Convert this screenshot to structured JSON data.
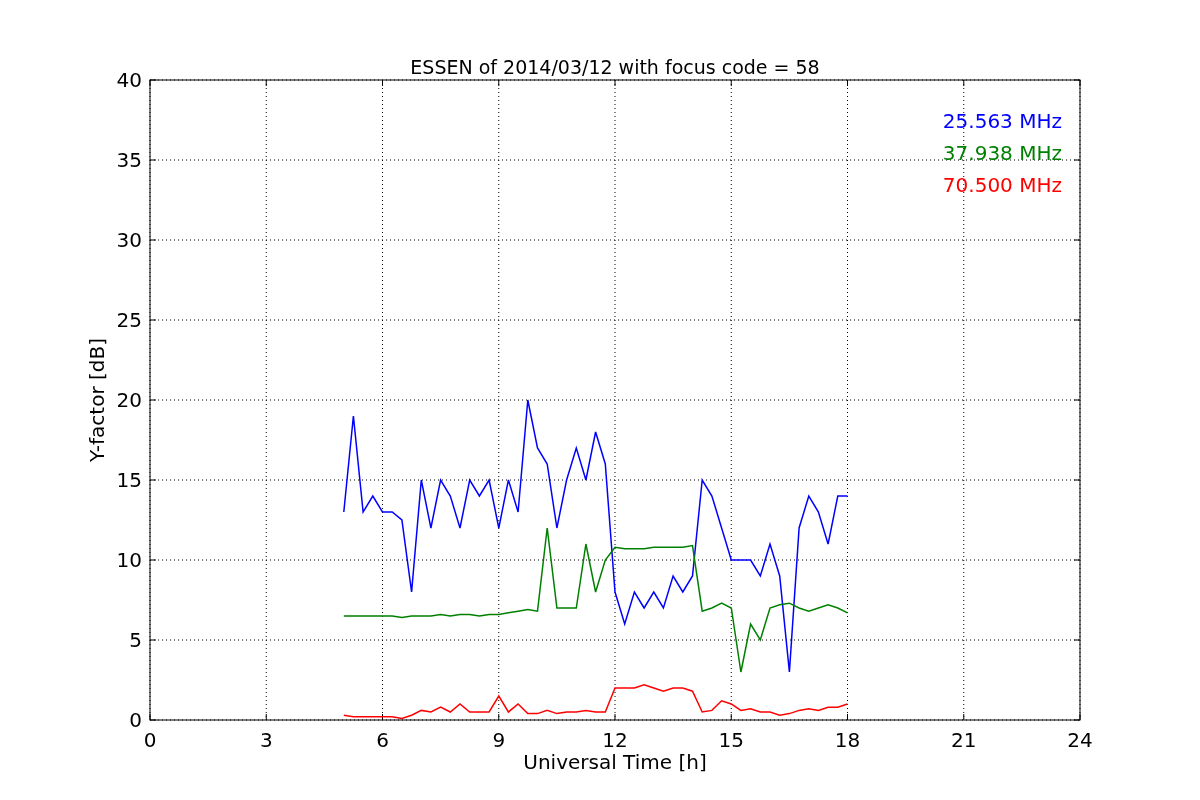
{
  "chart_data": {
    "type": "line",
    "title": "ESSEN of 2014/03/12 with focus code = 58",
    "xlabel": "Universal Time [h]",
    "ylabel": "Y-factor [dB]",
    "grid": true,
    "xlim": [
      0,
      24
    ],
    "ylim": [
      0,
      40
    ],
    "xticks": [
      0,
      3,
      6,
      9,
      12,
      15,
      18,
      21,
      24
    ],
    "yticks": [
      0,
      5,
      10,
      15,
      20,
      25,
      30,
      35,
      40
    ],
    "x": [
      5,
      5.25,
      5.5,
      5.75,
      6,
      6.25,
      6.5,
      6.75,
      7,
      7.25,
      7.5,
      7.75,
      8,
      8.25,
      8.5,
      8.75,
      9,
      9.25,
      9.5,
      9.75,
      10,
      10.25,
      10.5,
      10.75,
      11,
      11.25,
      11.5,
      11.75,
      12,
      12.25,
      12.5,
      12.75,
      13,
      13.25,
      13.5,
      13.75,
      14,
      14.25,
      14.5,
      14.75,
      15,
      15.25,
      15.5,
      15.75,
      16,
      16.25,
      16.5,
      16.75,
      17,
      17.25,
      17.5,
      17.75,
      18
    ],
    "series": [
      {
        "name": "25.563 MHz",
        "color": "#0000ff",
        "values": [
          13,
          19,
          13,
          14,
          13,
          13,
          12.5,
          8,
          15,
          12,
          15,
          14,
          12,
          15,
          14,
          15,
          12,
          15,
          13,
          20,
          17,
          16,
          12,
          15,
          17,
          15,
          18,
          16,
          8,
          6,
          8,
          7,
          8,
          7,
          9,
          8,
          9,
          15,
          14,
          12,
          10,
          10,
          10,
          9,
          11,
          9,
          3,
          12,
          14,
          13,
          11,
          14,
          14
        ]
      },
      {
        "name": "37.938 MHz",
        "color": "#008000",
        "values": [
          6.5,
          6.5,
          6.5,
          6.5,
          6.5,
          6.5,
          6.4,
          6.5,
          6.5,
          6.5,
          6.6,
          6.5,
          6.6,
          6.6,
          6.5,
          6.6,
          6.6,
          6.7,
          6.8,
          6.9,
          6.8,
          12,
          7,
          7,
          7,
          11,
          8,
          10,
          10.8,
          10.7,
          10.7,
          10.7,
          10.8,
          10.8,
          10.8,
          10.8,
          10.9,
          6.8,
          7,
          7.3,
          7,
          3,
          6,
          5,
          7,
          7.2,
          7.3,
          7,
          6.8,
          7,
          7.2,
          7,
          6.7
        ]
      },
      {
        "name": "70.500 MHz",
        "color": "#ff0000",
        "values": [
          0.3,
          0.2,
          0.2,
          0.2,
          0.2,
          0.2,
          0.1,
          0.3,
          0.6,
          0.5,
          0.8,
          0.5,
          1,
          0.5,
          0.5,
          0.5,
          1.5,
          0.5,
          1,
          0.4,
          0.4,
          0.6,
          0.4,
          0.5,
          0.5,
          0.6,
          0.5,
          0.5,
          2,
          2,
          2,
          2.2,
          2,
          1.8,
          2,
          2,
          1.8,
          0.5,
          0.6,
          1.2,
          1,
          0.6,
          0.7,
          0.5,
          0.5,
          0.3,
          0.4,
          0.6,
          0.7,
          0.6,
          0.8,
          0.8,
          1
        ]
      }
    ]
  }
}
